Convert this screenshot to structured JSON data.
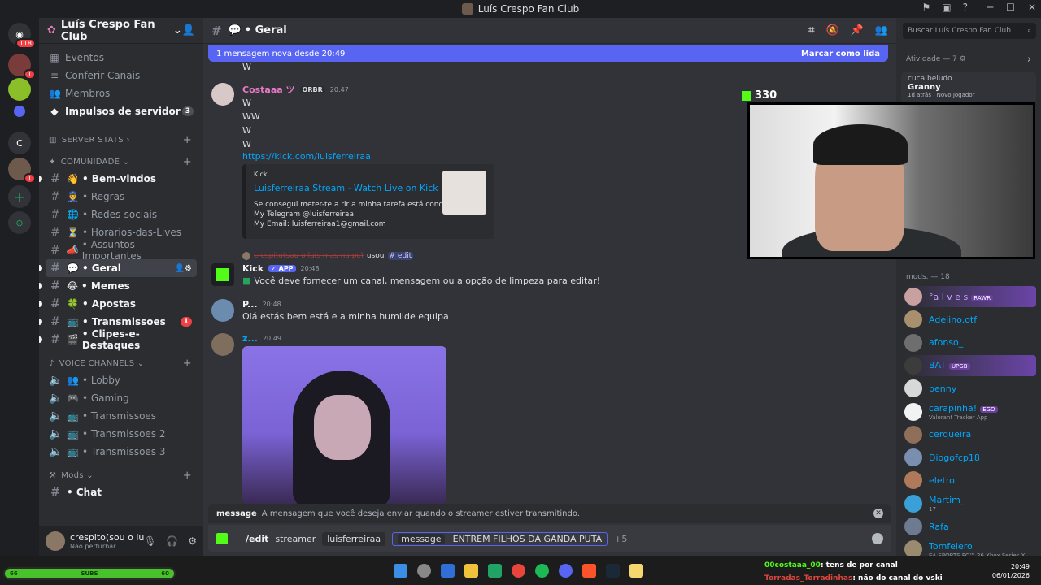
{
  "window": {
    "title": "Luís Crespo Fan Club"
  },
  "guilds": {
    "badge_count": "118",
    "badge_one": "1",
    "letter_c": "C"
  },
  "sidebar": {
    "server_name": "Luís Crespo Fan Club",
    "nav": [
      {
        "label": "Eventos",
        "icon": "calendar-icon"
      },
      {
        "label": "Conferir Canais",
        "icon": "browse-channels-icon"
      },
      {
        "label": "Membros",
        "icon": "members-icon"
      },
      {
        "label": "Impulsos de servidor",
        "icon": "boost-icon",
        "count": "3"
      }
    ],
    "cat_server_stats": "SERVER STATS",
    "cat_comunidade": "COMUNIDADE",
    "text_channels": [
      {
        "label": "• Bem-vindos",
        "emoji": "👋",
        "bold": true
      },
      {
        "label": "• Regras",
        "emoji": "👮",
        "bold": false
      },
      {
        "label": "• Redes-sociais",
        "emoji": "🌐",
        "bold": false
      },
      {
        "label": "• Horarios-das-Lives",
        "emoji": "⏳",
        "bold": false
      },
      {
        "label": "• Assuntos-Importantes",
        "emoji": "📣",
        "bold": false
      },
      {
        "label": "• Geral",
        "emoji": "💬",
        "bold": true,
        "active": true
      },
      {
        "label": "• Memes",
        "emoji": "😂",
        "bold": true
      },
      {
        "label": "• Apostas",
        "emoji": "🍀",
        "bold": true
      },
      {
        "label": "• Transmissoes",
        "emoji": "📺",
        "bold": true,
        "count": "1"
      },
      {
        "label": "• Clipes-e-Destaques",
        "emoji": "🎬",
        "bold": true
      }
    ],
    "cat_voice": "VOICE CHANNELS",
    "voice_channels": [
      {
        "label": "• Lobby",
        "emoji": "👥"
      },
      {
        "label": "• Gaming",
        "emoji": "🎮"
      },
      {
        "label": "• Transmissoes",
        "emoji": "📺"
      },
      {
        "label": "• Transmissoes 2",
        "emoji": "📺"
      },
      {
        "label": "• Transmissoes 3",
        "emoji": "📺"
      }
    ],
    "cat_mods": "Mods",
    "mods_channel": "• Chat"
  },
  "userbar": {
    "name": "crespito(sou o luis mas...",
    "status": "Não perturbar"
  },
  "channel": {
    "name": "Geral",
    "new_messages": "1 mensagem nova desde 20:49",
    "mark_read": "Marcar como lida"
  },
  "messages": {
    "top_w": "W",
    "m1": {
      "user": "Costaaa ツ",
      "tag": "ORBR",
      "time": "20:47",
      "lines": [
        "W",
        "WW",
        "W",
        "W"
      ],
      "link": "https://kick.com/luisferreiraa"
    },
    "embed": {
      "provider": "Kick",
      "title": "Luisferreiraa Stream - Watch Live on Kick",
      "desc1": "Se consegui meter-te a rir a minha tarefa está concluída.",
      "desc2": "My Telegram @luisferreiraa",
      "desc3": "My Email: luisferreiraa1@gmail.com"
    },
    "reply": {
      "user": "crespito(sou o luis mas na pc)",
      "used": "usou",
      "cmd": "edit"
    },
    "m2": {
      "user": "Kick",
      "tag": "✓ APP",
      "time": "20:48",
      "text": "Você deve fornecer um canal, mensagem ou a opção de limpeza para editar!"
    },
    "m3": {
      "user": "P...",
      "time": "20:48",
      "text": "Olá estás bem está e a minha humilde equipa"
    },
    "m4": {
      "user": "z...",
      "time": "20:49"
    }
  },
  "composer": {
    "hint_key": "message",
    "hint_text": "A mensagem que você deseja enviar quando o streamer estiver transmitindo.",
    "command": "/edit",
    "opt_streamer": "streamer",
    "val_streamer": "luisferreiraa",
    "opt_message": "message",
    "val_message": "ENTREM FILHOS DA GANDA PUTA",
    "more": "+5"
  },
  "right": {
    "search_placeholder": "Buscar Luís Crespo Fan Club",
    "activity_header": "Atividade — 7",
    "activity_user": "cuca beludo",
    "activity_game": "Granny",
    "activity_sub": "1d atrás · Novo Jogador",
    "mods_header": "mods. — 18",
    "members": [
      {
        "name": "°a l v e s",
        "tag": "RAWR",
        "color": "#c9a0ff",
        "hl": true
      },
      {
        "name": "Adelino.otf",
        "color": "#00a8fc"
      },
      {
        "name": "afonso_",
        "color": "#00a8fc"
      },
      {
        "name": "BAT",
        "tag": "UPGB",
        "color": "#00a8fc",
        "hl": true
      },
      {
        "name": "benny",
        "color": "#00a8fc"
      },
      {
        "name": "carapinha!",
        "tag": "EGO",
        "sub": "Valorant Tracker App",
        "color": "#00a8fc"
      },
      {
        "name": "cerqueira",
        "color": "#00a8fc"
      },
      {
        "name": "Diogofcp18",
        "color": "#00a8fc"
      },
      {
        "name": "eletro",
        "color": "#00a8fc"
      },
      {
        "name": "Martim_",
        "sub": "17",
        "color": "#00a8fc"
      },
      {
        "name": "Rafa",
        "color": "#00a8fc"
      },
      {
        "name": "Tomfeiero",
        "sub": "EA SPORTS FC™ 26 Xbox Series X",
        "color": "#00a8fc"
      }
    ]
  },
  "overlay": {
    "viewers": "330"
  },
  "taskbar": {
    "subs_left": "66",
    "subs_label": "SUBS",
    "subs_right": "60",
    "chat1_user": "00costaaa_00",
    "chat1_text": ": tens de por canal",
    "chat2_user": "Torradas_Torradinhas",
    "chat2_text": ": não do canal do vski",
    "time": "20:49",
    "date": "06/01/2026"
  }
}
